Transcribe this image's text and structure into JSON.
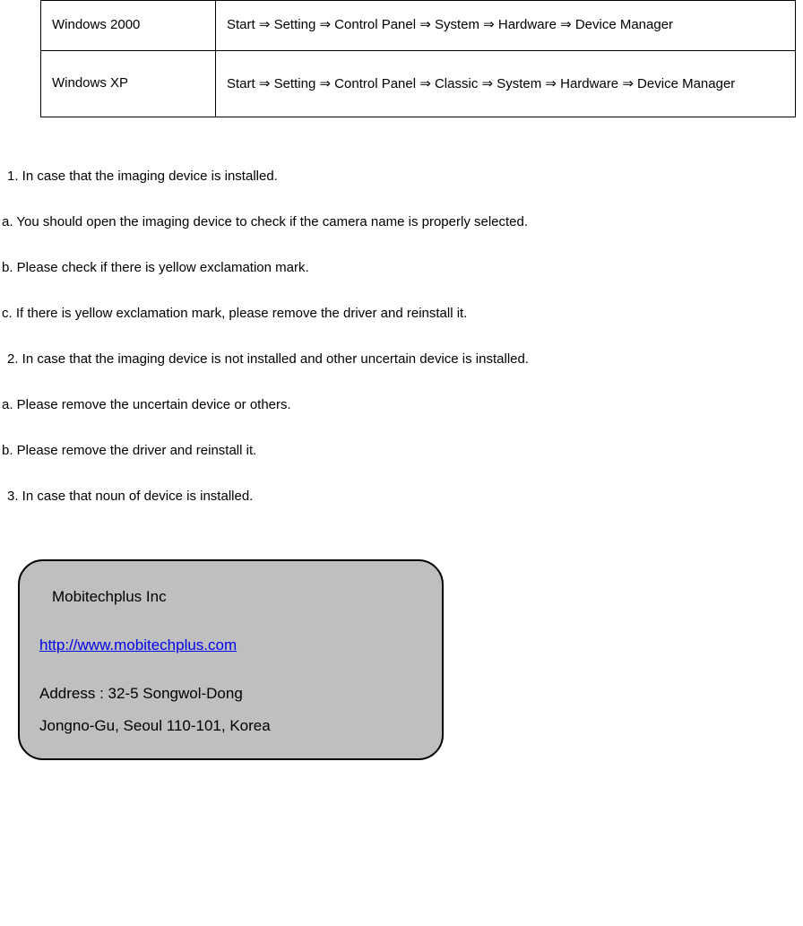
{
  "table": {
    "rows": [
      {
        "os": "Windows 2000",
        "path": "Start  ⇒  Setting  ⇒  Control Panel  ⇒  System  ⇒  Hardware  ⇒  Device Manager"
      },
      {
        "os": "Windows XP",
        "path": "Start  ⇒  Setting  ⇒  Control  Panel  ⇒  Classic  ⇒  System  ⇒  Hardware  ⇒  Device Manager"
      }
    ]
  },
  "steps": {
    "s1": "1. In case that the imaging device is installed.",
    "s1a": "a. You should open the imaging device to check if the camera name is properly selected.",
    "s1b": "b. Please check if there is yellow exclamation mark.",
    "s1c": "c. If there is yellow exclamation mark, please remove the driver and reinstall it.",
    "s2": "2. In case that the imaging device is not installed and other uncertain device is installed.",
    "s2a": "a. Please remove the uncertain device or others.",
    "s2b": "b. Please remove the driver and reinstall it.",
    "s3": "3. In case that noun of device is installed."
  },
  "info": {
    "company": "Mobitechplus Inc",
    "url": "http://www.mobitechplus.com",
    "address1": "Address : 32-5 Songwol-Dong",
    "address2": "Jongno-Gu, Seoul 110-101, Korea"
  }
}
